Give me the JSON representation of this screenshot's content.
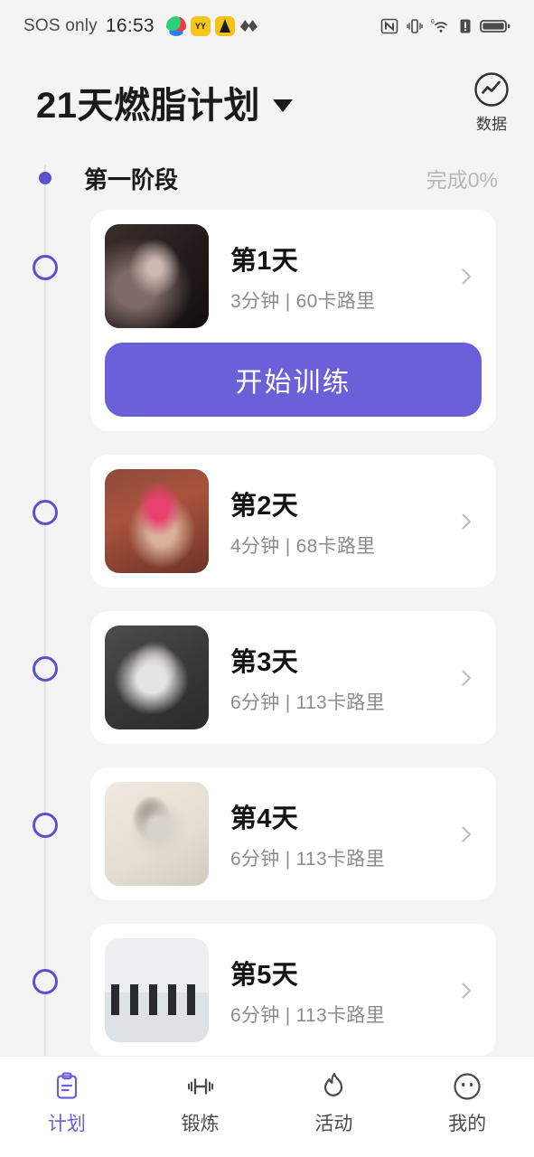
{
  "status_bar": {
    "carrier": "SOS only",
    "time": "16:53",
    "app_icons": [
      "app-badge-1",
      "app-badge-yy",
      "app-badge-3",
      "app-badge-4"
    ],
    "right_icons": [
      "nfc-icon",
      "vibrate-icon",
      "wifi6-icon",
      "sim-alert-icon",
      "battery-icon"
    ]
  },
  "header": {
    "title": "21天燃脂计划",
    "caret": "chevron-down-icon",
    "data_label": "数据",
    "data_icon": "chart-circle-icon"
  },
  "phase": {
    "name": "第一阶段",
    "progress_label": "完成0%"
  },
  "days": [
    {
      "title": "第1天",
      "meta": "3分钟 | 60卡路里",
      "duration": "3分钟",
      "calories": "60卡路里",
      "thumb": "dancer-dark-stage",
      "has_start_button": true,
      "start_label": "开始训练"
    },
    {
      "title": "第2天",
      "meta": "4分钟 | 68卡路里",
      "duration": "4分钟",
      "calories": "68卡路里",
      "thumb": "gym-box-jump",
      "has_start_button": false
    },
    {
      "title": "第3天",
      "meta": "6分钟 | 113卡路里",
      "duration": "6分钟",
      "calories": "113卡路里",
      "thumb": "dancer-grey-skirt",
      "has_start_button": false
    },
    {
      "title": "第4天",
      "meta": "6分钟 | 113卡路里",
      "duration": "6分钟",
      "calories": "113卡路里",
      "thumb": "dancer-cream-studio",
      "has_start_button": false
    },
    {
      "title": "第5天",
      "meta": "6分钟 | 113卡路里",
      "duration": "6分钟",
      "calories": "113卡路里",
      "thumb": "group-class-lunge",
      "has_start_button": false
    }
  ],
  "tabbar": {
    "items": [
      {
        "label": "计划",
        "icon": "clipboard-icon",
        "active": true
      },
      {
        "label": "锻炼",
        "icon": "dumbbell-icon",
        "active": false
      },
      {
        "label": "活动",
        "icon": "flame-icon",
        "active": false
      },
      {
        "label": "我的",
        "icon": "face-icon",
        "active": false
      }
    ]
  },
  "colors": {
    "accent": "#6a61d8",
    "timeline": "#5b51cf",
    "background": "#f4f4f4",
    "card": "#ffffff",
    "muted_text": "#8c8c8c"
  }
}
